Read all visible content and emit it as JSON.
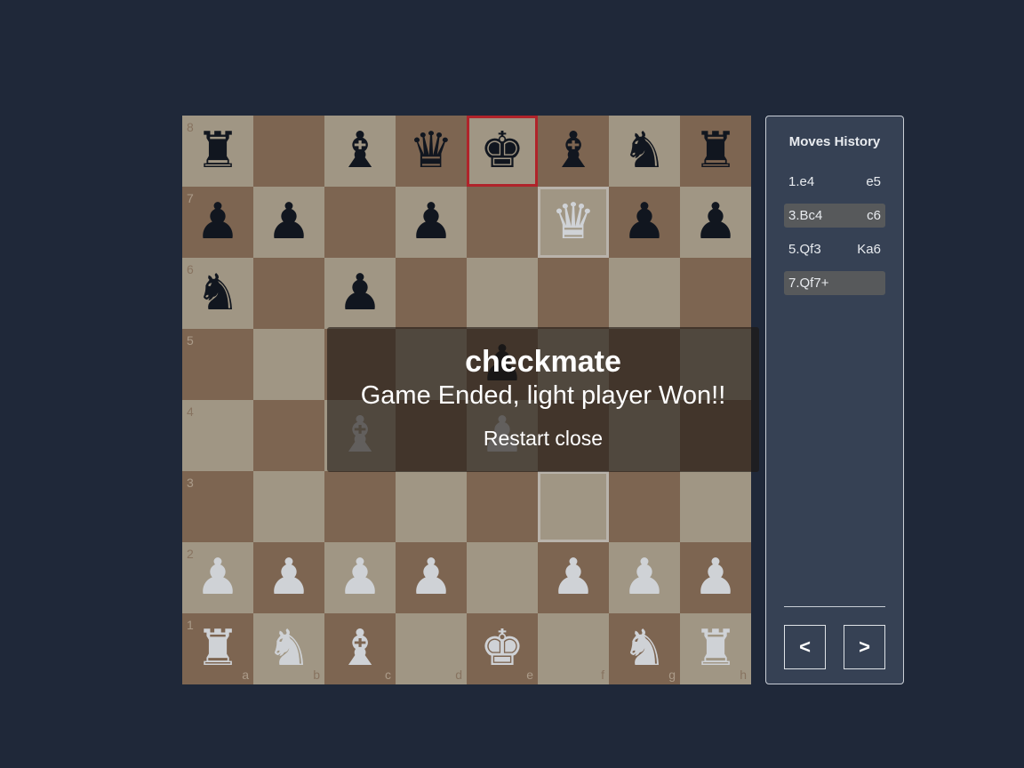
{
  "board": {
    "ranks": [
      [
        {
          "p": "♜",
          "c": "b"
        },
        {
          "p": "",
          "c": ""
        },
        {
          "p": "♝",
          "c": "b"
        },
        {
          "p": "♛",
          "c": "b"
        },
        {
          "p": "♚",
          "c": "b"
        },
        {
          "p": "♝",
          "c": "b"
        },
        {
          "p": "♞",
          "c": "b"
        },
        {
          "p": "♜",
          "c": "b"
        }
      ],
      [
        {
          "p": "♟",
          "c": "b"
        },
        {
          "p": "♟",
          "c": "b"
        },
        {
          "p": "",
          "c": ""
        },
        {
          "p": "♟",
          "c": "b"
        },
        {
          "p": "",
          "c": ""
        },
        {
          "p": "♛",
          "c": "w"
        },
        {
          "p": "♟",
          "c": "b"
        },
        {
          "p": "♟",
          "c": "b"
        }
      ],
      [
        {
          "p": "♞",
          "c": "b"
        },
        {
          "p": "",
          "c": ""
        },
        {
          "p": "♟",
          "c": "b"
        },
        {
          "p": "",
          "c": ""
        },
        {
          "p": "",
          "c": ""
        },
        {
          "p": "",
          "c": ""
        },
        {
          "p": "",
          "c": ""
        },
        {
          "p": "",
          "c": ""
        }
      ],
      [
        {
          "p": "",
          "c": ""
        },
        {
          "p": "",
          "c": ""
        },
        {
          "p": "",
          "c": ""
        },
        {
          "p": "",
          "c": ""
        },
        {
          "p": "♟",
          "c": "b"
        },
        {
          "p": "",
          "c": ""
        },
        {
          "p": "",
          "c": ""
        },
        {
          "p": "",
          "c": ""
        }
      ],
      [
        {
          "p": "",
          "c": ""
        },
        {
          "p": "",
          "c": ""
        },
        {
          "p": "♝",
          "c": "w"
        },
        {
          "p": "",
          "c": ""
        },
        {
          "p": "♟",
          "c": "w"
        },
        {
          "p": "",
          "c": ""
        },
        {
          "p": "",
          "c": ""
        },
        {
          "p": "",
          "c": ""
        }
      ],
      [
        {
          "p": "",
          "c": ""
        },
        {
          "p": "",
          "c": ""
        },
        {
          "p": "",
          "c": ""
        },
        {
          "p": "",
          "c": ""
        },
        {
          "p": "",
          "c": ""
        },
        {
          "p": "",
          "c": ""
        },
        {
          "p": "",
          "c": ""
        },
        {
          "p": "",
          "c": ""
        }
      ],
      [
        {
          "p": "♟",
          "c": "w"
        },
        {
          "p": "♟",
          "c": "w"
        },
        {
          "p": "♟",
          "c": "w"
        },
        {
          "p": "♟",
          "c": "w"
        },
        {
          "p": "",
          "c": ""
        },
        {
          "p": "♟",
          "c": "w"
        },
        {
          "p": "♟",
          "c": "w"
        },
        {
          "p": "♟",
          "c": "w"
        }
      ],
      [
        {
          "p": "♜",
          "c": "w"
        },
        {
          "p": "♞",
          "c": "w"
        },
        {
          "p": "♝",
          "c": "w"
        },
        {
          "p": "",
          "c": ""
        },
        {
          "p": "♚",
          "c": "w"
        },
        {
          "p": "",
          "c": ""
        },
        {
          "p": "♞",
          "c": "w"
        },
        {
          "p": "♜",
          "c": "w"
        }
      ]
    ],
    "rank_labels": [
      "8",
      "7",
      "6",
      "5",
      "4",
      "3",
      "2",
      "1"
    ],
    "file_labels": [
      "a",
      "b",
      "c",
      "d",
      "e",
      "f",
      "g",
      "h"
    ],
    "check_square": "e8",
    "highlight_squares": [
      "f7",
      "f3"
    ]
  },
  "dialog": {
    "title": "checkmate",
    "message": "Game Ended, light player Won!!",
    "restart_label": "Restart",
    "close_label": "close"
  },
  "history": {
    "title": "Moves History",
    "rows": [
      {
        "num": "1.",
        "white": "e4",
        "black": "e5",
        "active": false
      },
      {
        "num": "3.",
        "white": "Bc4",
        "black": "c6",
        "active": true
      },
      {
        "num": "5.",
        "white": "Qf3",
        "black": "Ka6",
        "active": false
      },
      {
        "num": "7.",
        "white": "Qf7+",
        "black": "",
        "active": true
      }
    ],
    "prev_label": "<",
    "next_label": ">"
  }
}
